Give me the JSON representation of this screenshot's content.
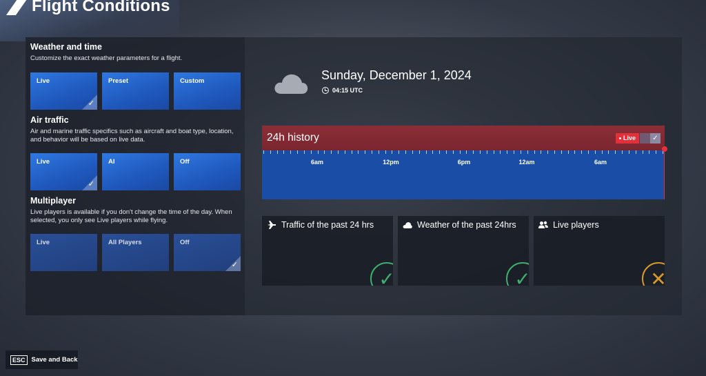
{
  "page": {
    "title": "Flight Conditions"
  },
  "weather_time": {
    "title": "Weather and time",
    "description": "Customize the exact weather parameters for a flight.",
    "options": [
      {
        "label": "Live",
        "selected": true
      },
      {
        "label": "Preset",
        "selected": false
      },
      {
        "label": "Custom",
        "selected": false
      }
    ]
  },
  "air_traffic": {
    "title": "Air traffic",
    "description": "Air and marine traffic specifics such as aircraft and boat type, location, and behavior will be based on live data.",
    "options": [
      {
        "label": "Live",
        "selected": true
      },
      {
        "label": "AI",
        "selected": false
      },
      {
        "label": "Off",
        "selected": false
      }
    ]
  },
  "multiplayer": {
    "title": "Multiplayer",
    "description": "Live players is available if you don't change the time of the day. When selected, you only see Live players while flying.",
    "options": [
      {
        "label": "Live",
        "selected": false
      },
      {
        "label": "All Players",
        "selected": false
      },
      {
        "label": "Off",
        "selected": true
      }
    ]
  },
  "conditions": {
    "date": "Sunday, December 1, 2024",
    "time": "04:15 UTC",
    "weather_icon": "cloud-icon"
  },
  "history": {
    "title": "24h history",
    "live_label": "Live",
    "tick_labels": [
      "6am",
      "12pm",
      "6pm",
      "12am",
      "6am"
    ]
  },
  "status_cards": [
    {
      "label": "Traffic of the past 24 hrs",
      "icon": "airplane-icon",
      "status": "check"
    },
    {
      "label": "Weather of the past 24hrs",
      "icon": "cloud-icon",
      "status": "check"
    },
    {
      "label": "Live players",
      "icon": "users-icon",
      "status": "cross"
    }
  ],
  "footer": {
    "key": "ESC",
    "action": "Save and Back"
  },
  "colors": {
    "accent_blue": "#1f58bd",
    "live_red": "#e3303a",
    "ok_green": "#3fae6e",
    "off_orange": "#d89a2d"
  }
}
